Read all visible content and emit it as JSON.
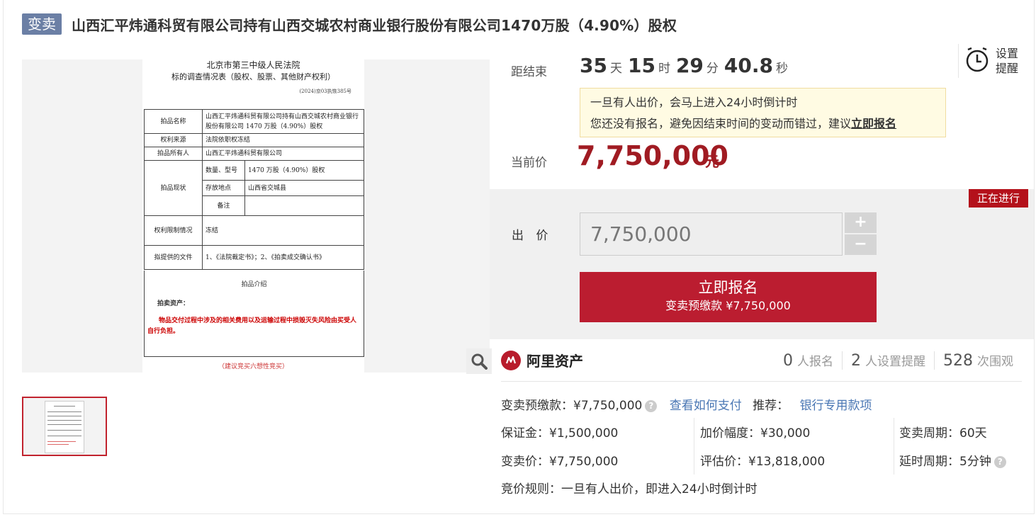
{
  "header": {
    "badge": "变卖",
    "title": "山西汇平炜通科贸有限公司持有山西交城农村商业银行股份有限公司1470万股（4.90%）股权"
  },
  "document": {
    "court": "北京市第三中级人民法院",
    "subtitle": "标的调查情况表（股权、股票、其他财产权利）",
    "case_no": "(2024)京03执恢385号",
    "rows": [
      {
        "label": "拍品名称",
        "value": "山西汇平炜通科贸有限公司持有山西交城农村商业银行股份有限公司 1470 万股（4.90%）股权"
      },
      {
        "label": "权利来源",
        "value": "法院依职权冻结"
      },
      {
        "label": "拍品所有人",
        "value": "山西汇平炜通科贸有限公司"
      },
      {
        "label": "拍品现状",
        "sub": [
          {
            "label": "数量、型号",
            "value": "1470 万股（4.90%）股权"
          },
          {
            "label": "存放地点",
            "value": "山西省交城县"
          },
          {
            "label": "备注",
            "value": ""
          }
        ]
      },
      {
        "label": "权利限制情况",
        "value": "冻结"
      },
      {
        "label": "拟提供的文件",
        "value": "1、《法院裁定书》；2、《拍卖成交确认书》"
      }
    ],
    "intro_title": "拍品介绍",
    "intro_sub": "拍卖资产：",
    "intro_red": "物品交付过程中涉及的相关费用以及运输过程中损毁灭失风险由买受人自行负担。",
    "footer": "（建议竞买六想性竞买）"
  },
  "countdown": {
    "label": "距结束",
    "days": "35",
    "days_unit": "天",
    "hours": "15",
    "hours_unit": "时",
    "minutes": "29",
    "minutes_unit": "分",
    "seconds": "40.8",
    "seconds_unit": "秒"
  },
  "reminder": {
    "label": "设置提醒"
  },
  "notice": {
    "line1": "一旦有人出价，会马上进入24小时倒计时",
    "line2": "您还没有报名，避免因结束时间的变动而错过，建议",
    "link": "立即报名"
  },
  "current_price": {
    "label": "当前价",
    "value": "7,750,000",
    "unit": "元"
  },
  "status": "正在进行",
  "bid": {
    "label": "出 价",
    "value": "7,750,000",
    "plus": "+",
    "minus": "−"
  },
  "apply_button": {
    "main": "立即报名",
    "sub": "变卖预缴款 ¥7,750,000"
  },
  "brand": {
    "name": "阿里资产"
  },
  "stats": [
    {
      "num": "0",
      "label": "人报名"
    },
    {
      "num": "2",
      "label": "人设置提醒"
    },
    {
      "num": "528",
      "label": "次围观"
    }
  ],
  "info": {
    "deposit": "变卖预缴款：¥7,750,000",
    "how_to_pay": "查看如何支付",
    "recommend_label": "推荐：",
    "recommend_link": "银行专用款项",
    "margin": "保证金：¥1,500,000",
    "increment": "加价幅度：¥30,000",
    "period": "变卖周期：60天",
    "sale_price": "变卖价：¥7,750,000",
    "appraisal": "评估价：¥13,818,000",
    "delay": "延时周期：5分钟",
    "rule": "竞价规则：一旦有人出价，即进入24小时倒计时"
  },
  "colors": {
    "accent": "#b4111b",
    "badge": "#6b7fa5",
    "link": "#4a77b4"
  }
}
